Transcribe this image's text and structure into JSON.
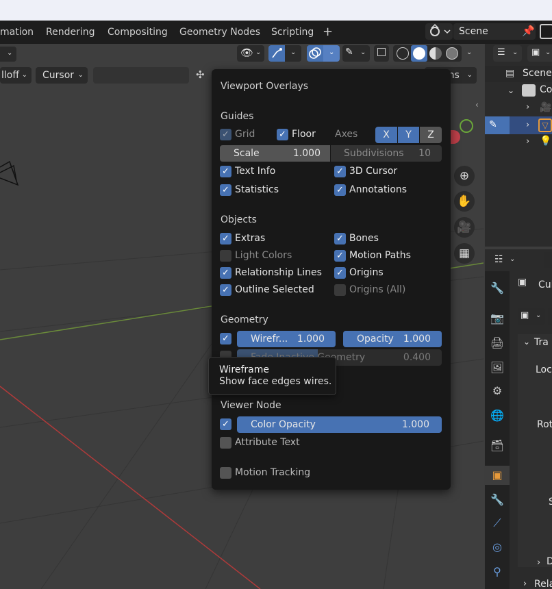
{
  "workspace_tabs": [
    "mation",
    "Rendering",
    "Compositing",
    "Geometry Nodes",
    "Scripting",
    "+"
  ],
  "scene": {
    "name": "Scene"
  },
  "viewport_header": {
    "falloff_label": "lloff",
    "pivot_label": "Cursor",
    "partial_right": "ons"
  },
  "overlays": {
    "title": "Viewport Overlays",
    "guides": {
      "heading": "Guides",
      "grid": "Grid",
      "floor": "Floor",
      "axes_label": "Axes",
      "axis_x": "X",
      "axis_y": "Y",
      "axis_z": "Z",
      "scale_label": "Scale",
      "scale_value": "1.000",
      "subdiv_label": "Subdivisions",
      "subdiv_value": "10",
      "text_info": "Text Info",
      "cursor_3d": "3D Cursor",
      "statistics": "Statistics",
      "annotations": "Annotations"
    },
    "objects": {
      "heading": "Objects",
      "extras": "Extras",
      "bones": "Bones",
      "light_colors": "Light Colors",
      "motion_paths": "Motion Paths",
      "relationship_lines": "Relationship Lines",
      "origins": "Origins",
      "outline_selected": "Outline Selected",
      "origins_all": "Origins (All)"
    },
    "geometry": {
      "heading": "Geometry",
      "wireframe_label": "Wirefr...",
      "wireframe_value": "1.000",
      "opacity_label": "Opacity",
      "opacity_value": "1.000",
      "fade_label": "Fade Inactive Geometry",
      "fade_value": "0.400"
    },
    "viewer_node": {
      "heading": "Viewer Node",
      "color_opacity_label": "Color Opacity",
      "color_opacity_value": "1.000",
      "attribute_text": "Attribute Text"
    },
    "motion_tracking": "Motion Tracking"
  },
  "tooltip": {
    "title": "Wireframe",
    "description": "Show face edges wires."
  },
  "outliner": {
    "scene_label": "Scene",
    "collection_partial": "Co"
  },
  "properties": {
    "object_partial": "Cul",
    "transform_partial": "Tra",
    "location_partial": "Loc",
    "rotation_partial": "Rot",
    "scale_partial": "S",
    "delta_partial": "D",
    "relations_partial": "Rela"
  }
}
